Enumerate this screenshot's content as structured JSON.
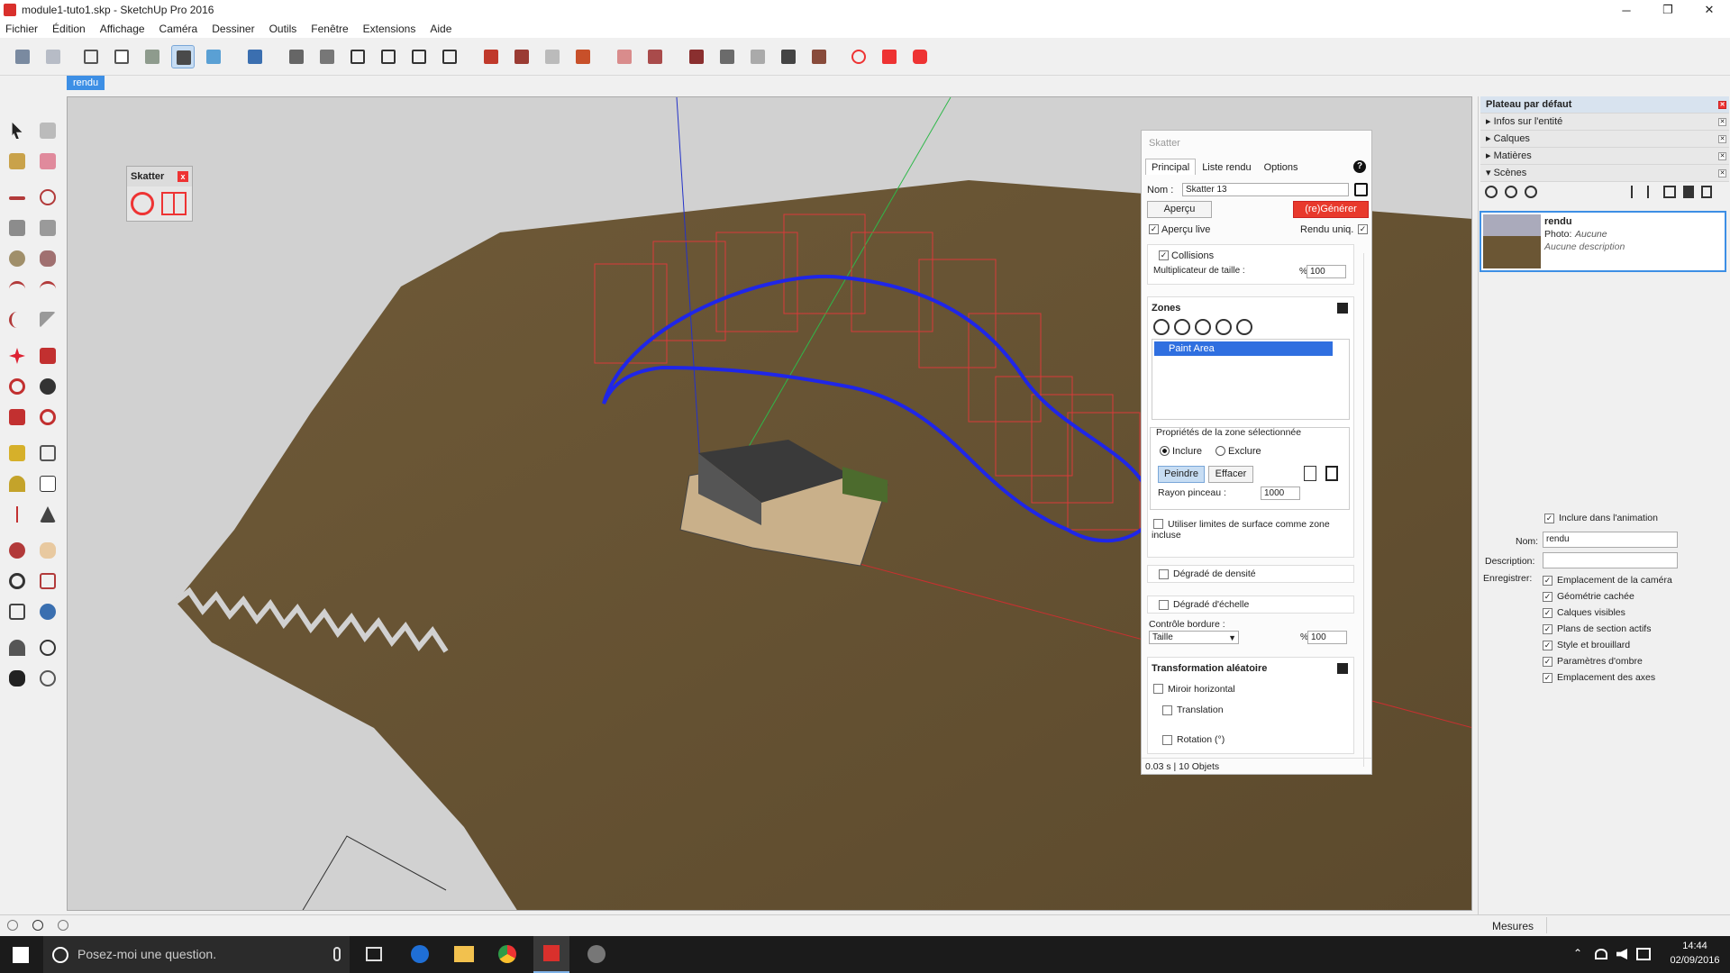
{
  "window": {
    "title": "module1-tuto1.skp - SketchUp Pro 2016",
    "minimize": "─",
    "maximize": "❐",
    "close": "✕"
  },
  "menu": [
    "Fichier",
    "Édition",
    "Affichage",
    "Caméra",
    "Dessiner",
    "Outils",
    "Fenêtre",
    "Extensions",
    "Aide"
  ],
  "scene_tab": "rendu",
  "skatter_mini": {
    "title": "Skatter",
    "close": "x"
  },
  "skatter": {
    "title": "Skatter",
    "tabs": [
      "Principal",
      "Liste rendu",
      "Options"
    ],
    "help": "?",
    "name_label": "Nom :",
    "name_value": "Skatter 13",
    "apercu_button": "Aperçu",
    "generate_button": "(re)Générer",
    "apercu_live": "Aperçu live",
    "rendu_uniq": "Rendu uniq.",
    "collisions": "Collisions",
    "mult_label": "Multiplicateur de taille :",
    "percent": "%",
    "mult_value": "100",
    "zones_title": "Zones",
    "zone_item": "Paint Area",
    "props_title": "Propriétés de la zone sélectionnée",
    "include": "Inclure",
    "exclude": "Exclure",
    "peindre": "Peindre",
    "effacer": "Effacer",
    "rayon_label": "Rayon pinceau :",
    "rayon_value": "1000",
    "limites": "Utiliser limites de surface comme zone incluse",
    "degrade_densite": "Dégradé de densité",
    "degrade_echelle": "Dégradé d'échelle",
    "controle_bordure": "Contrôle bordure :",
    "taille": "Taille",
    "bordure_value": "100",
    "transformation_title": "Transformation aléatoire",
    "miroir": "Miroir horizontal",
    "translation": "Translation",
    "rotation": "Rotation (°)",
    "status": "0.03 s | 10 Objets"
  },
  "tray": {
    "title": "Plateau par défaut",
    "sections": [
      "Infos sur l'entité",
      "Calques",
      "Matières",
      "Scènes"
    ],
    "scene_name": "rendu",
    "photo_label": "Photo:",
    "photo_value": "Aucune",
    "description_placeholder": "Aucune description",
    "include_anim": "Inclure dans l'animation",
    "nom_label": "Nom:",
    "nom_value": "rendu",
    "desc_label": "Description:",
    "save_label": "Enregistrer:",
    "save_items": [
      "Emplacement de la caméra",
      "Géométrie cachée",
      "Calques visibles",
      "Plans de section actifs",
      "Style et brouillard",
      "Paramètres d'ombre",
      "Emplacement des axes"
    ]
  },
  "status": {
    "mesures": "Mesures"
  },
  "taskbar": {
    "search_placeholder": "Posez-moi une question.",
    "time": "14:44",
    "date": "02/09/2016"
  },
  "colors": {
    "accent": "#3d8fe5",
    "generate": "#e8392c",
    "zone_selected": "#2f6fe0",
    "ground": "#6b5634"
  }
}
